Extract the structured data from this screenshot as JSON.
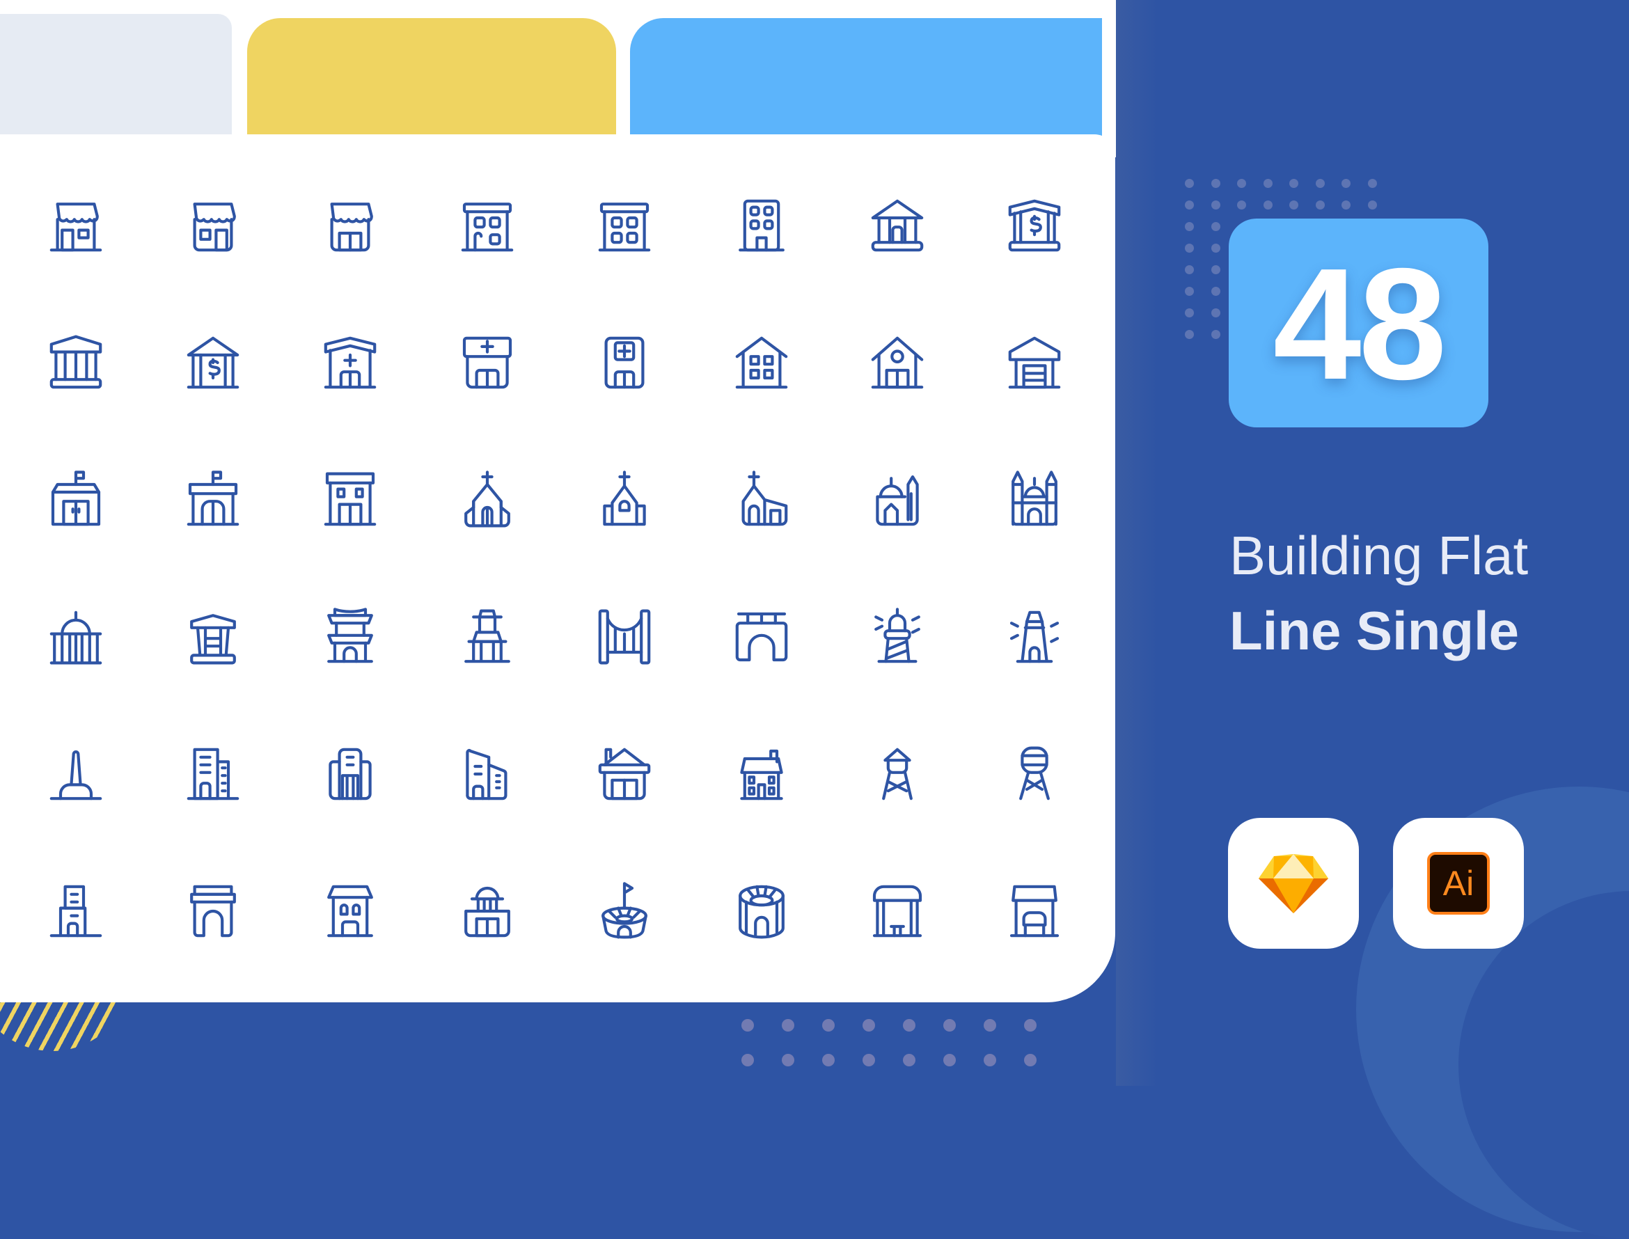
{
  "product": {
    "count": "48",
    "title_line1": "Building Flat",
    "title_line2": "Line Single"
  },
  "colors": {
    "background_blue": "#2e54a4",
    "accent_light_blue": "#5cb4fb",
    "accent_yellow": "#efd461",
    "tab_gray": "#e6ebf3",
    "icon_stroke": "#2e54a4",
    "card_white": "#ffffff"
  },
  "tabs": [
    {
      "name": "gray",
      "color": "#e6ebf3"
    },
    {
      "name": "yellow",
      "color": "#efd461"
    },
    {
      "name": "blue",
      "color": "#5cb4fb"
    }
  ],
  "software": [
    {
      "name": "Sketch",
      "icon": "sketch-diamond-icon"
    },
    {
      "name": "Adobe Illustrator",
      "icon": "illustrator-icon",
      "label": "Ai"
    }
  ],
  "icon_grid": {
    "rows": 6,
    "columns": 8,
    "icons": [
      [
        "shop",
        "shop-2",
        "store",
        "apartment",
        "office-building",
        "tall-building",
        "bank",
        "bank-dollar"
      ],
      [
        "museum",
        "bank-dollar-2",
        "hospital",
        "clinic",
        "medical-building",
        "house-windows",
        "barn",
        "garage"
      ],
      [
        "school",
        "school-2",
        "hotel",
        "church",
        "chapel",
        "church-annex",
        "mosque",
        "cathedral"
      ],
      [
        "capitol",
        "pavilion",
        "pagoda",
        "temple",
        "suspension-bridge",
        "bridge",
        "lighthouse",
        "lighthouse-2"
      ],
      [
        "obelisk",
        "skyscraper",
        "corporate-building",
        "modern-office",
        "farmhouse",
        "townhouse",
        "water-tower",
        "water-tower-2"
      ],
      [
        "tower-block",
        "arch",
        "shop-house",
        "courthouse",
        "stadium",
        "arena",
        "bus-stop",
        "kiosk"
      ]
    ]
  }
}
